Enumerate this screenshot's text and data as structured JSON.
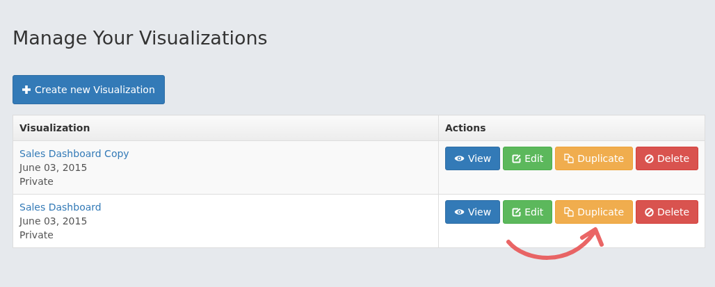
{
  "page_title": "Manage Your Visualizations",
  "create_button": {
    "label": "Create new Visualization"
  },
  "table": {
    "columns": [
      "Visualization",
      "Actions"
    ],
    "rows": [
      {
        "name": "Sales Dashboard Copy",
        "date": "June 03, 2015",
        "visibility": "Private",
        "actions": [
          {
            "kind": "view",
            "label": "View"
          },
          {
            "kind": "edit",
            "label": "Edit"
          },
          {
            "kind": "duplicate",
            "label": "Duplicate"
          },
          {
            "kind": "delete",
            "label": "Delete"
          }
        ]
      },
      {
        "name": "Sales Dashboard",
        "date": "June 03, 2015",
        "visibility": "Private",
        "actions": [
          {
            "kind": "view",
            "label": "View"
          },
          {
            "kind": "edit",
            "label": "Edit"
          },
          {
            "kind": "duplicate",
            "label": "Duplicate"
          },
          {
            "kind": "delete",
            "label": "Delete"
          }
        ]
      }
    ]
  }
}
